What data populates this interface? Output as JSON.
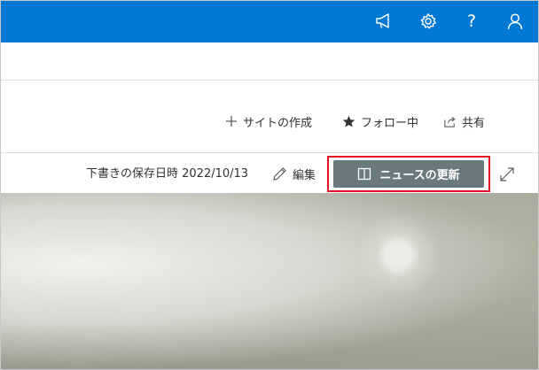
{
  "colors": {
    "suite_bar": "#0078d4",
    "news_button_bg": "#69797e",
    "highlight_border": "#e81123"
  },
  "suite_bar": {
    "icons": [
      "megaphone-icon",
      "gear-icon",
      "help-icon",
      "person-icon"
    ],
    "help_glyph": "?"
  },
  "commands": {
    "create_site": {
      "icon": "plus-icon",
      "label": "サイトの作成"
    },
    "follow": {
      "icon": "star-filled-icon",
      "label": "フォロー中"
    },
    "share": {
      "icon": "share-icon",
      "label": "共有"
    }
  },
  "edit_toolbar": {
    "draft_saved_text": "下書きの保存日時 2022/10/13",
    "edit_label": "編集",
    "news_update_label": "ニュースの更新",
    "expand_icon": "expand-icon"
  }
}
